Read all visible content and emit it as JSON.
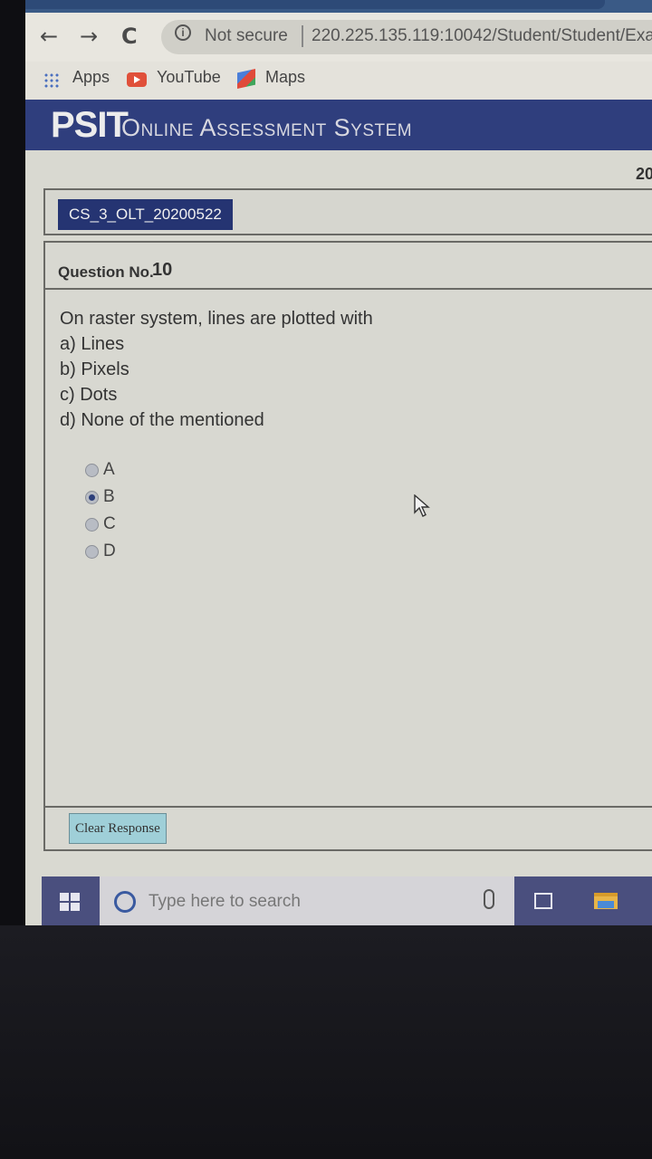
{
  "browser": {
    "back_icon": "arrow-left-icon",
    "forward_icon": "arrow-right-icon",
    "reload_icon": "reload-icon",
    "security_label": "Not secure",
    "url": "220.225.135.119:10042/Student/Student/Exa",
    "bookmarks": [
      {
        "label": "Apps",
        "icon": "apps-grid-icon"
      },
      {
        "label": "YouTube",
        "icon": "youtube-icon"
      },
      {
        "label": "Maps",
        "icon": "maps-icon"
      }
    ]
  },
  "site": {
    "brand": "PSIT",
    "title": "Online Assessment System",
    "year_fragment": "20",
    "header_color": "#2f3e7d"
  },
  "exam": {
    "code": "CS_3_OLT_20200522"
  },
  "question": {
    "number_label": "Question No.",
    "number": "10",
    "text": "On raster system, lines are plotted with",
    "options": [
      "a) Lines",
      "b) Pixels",
      "c) Dots",
      "d) None of the mentioned"
    ],
    "choices": [
      {
        "label": "A",
        "selected": false
      },
      {
        "label": "B",
        "selected": true
      },
      {
        "label": "C",
        "selected": false
      },
      {
        "label": "D",
        "selected": false
      }
    ],
    "clear_label": "Clear Response"
  },
  "taskbar": {
    "search_placeholder": "Type here to search",
    "start_icon": "windows-logo-icon",
    "accent_color": "#4a4f7e"
  }
}
